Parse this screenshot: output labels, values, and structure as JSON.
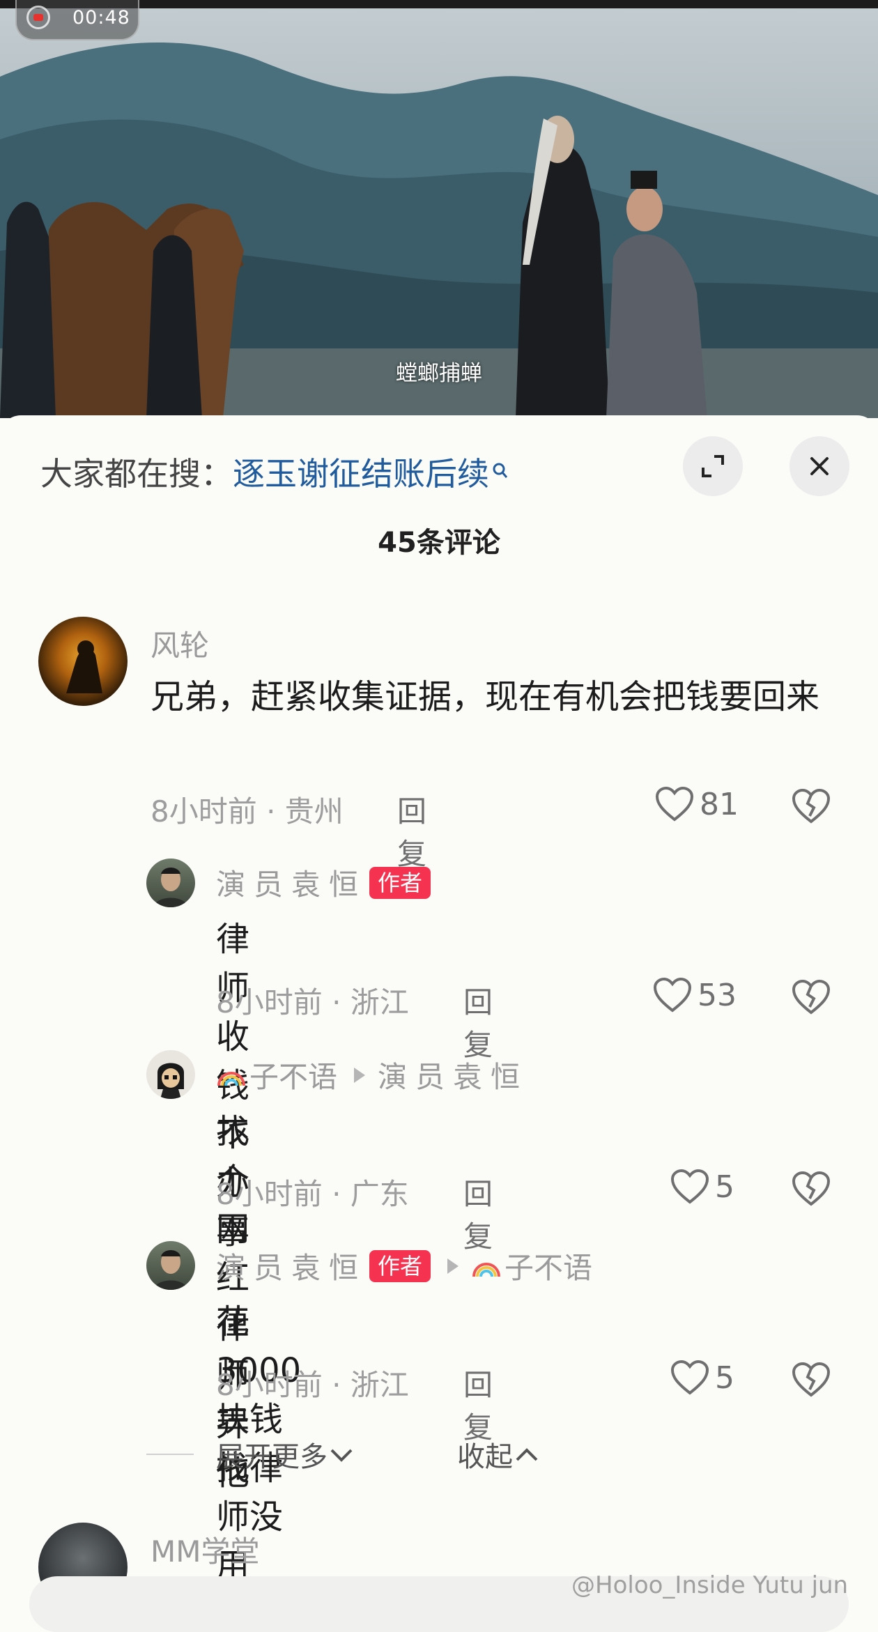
{
  "video": {
    "recording_time": "00:48",
    "subtitle": "螳螂捕蝉"
  },
  "search": {
    "prefix": "大家都在搜：",
    "term": "逐玉谢征结账后续"
  },
  "comment_count": "45条评论",
  "comments": [
    {
      "user": "风轮",
      "text": "兄弟，赶紧收集证据，现在有机会把钱要回来",
      "time": "8小时前",
      "location": "贵州",
      "reply": "回复",
      "likes": "81"
    },
    {
      "user": "演员袁恒",
      "tag": "作者",
      "text": "律师收钱不办事",
      "time": "8小时前",
      "location": "浙江",
      "reply": "回复",
      "likes": "53"
    },
    {
      "user": "子不语",
      "reply_to": "演员袁恒",
      "text": "找个网红律师弄他",
      "time": "8小时前",
      "location": "广东",
      "reply": "回复",
      "likes": "5"
    },
    {
      "user": "演员袁恒",
      "tag": "作者",
      "reply_to": "子不语",
      "text": "花3000块钱找律师没用",
      "time": "8小时前",
      "location": "浙江",
      "reply": "回复",
      "likes": "5"
    },
    {
      "user": "MM学堂"
    }
  ],
  "expand_more": "展开更多",
  "collapse": "收起",
  "watermark": "@Holoo_Inside  Yutu jun",
  "colors": {
    "author_tag": "#f5324f",
    "search_term": "#205b9e",
    "recording_dot": "#e8322e"
  },
  "icons": [
    "record-icon",
    "search-icon",
    "expand-icon",
    "close-icon",
    "heart-icon",
    "broken-heart-icon",
    "chevron-down-icon",
    "chevron-up-icon",
    "rainbow-icon"
  ]
}
